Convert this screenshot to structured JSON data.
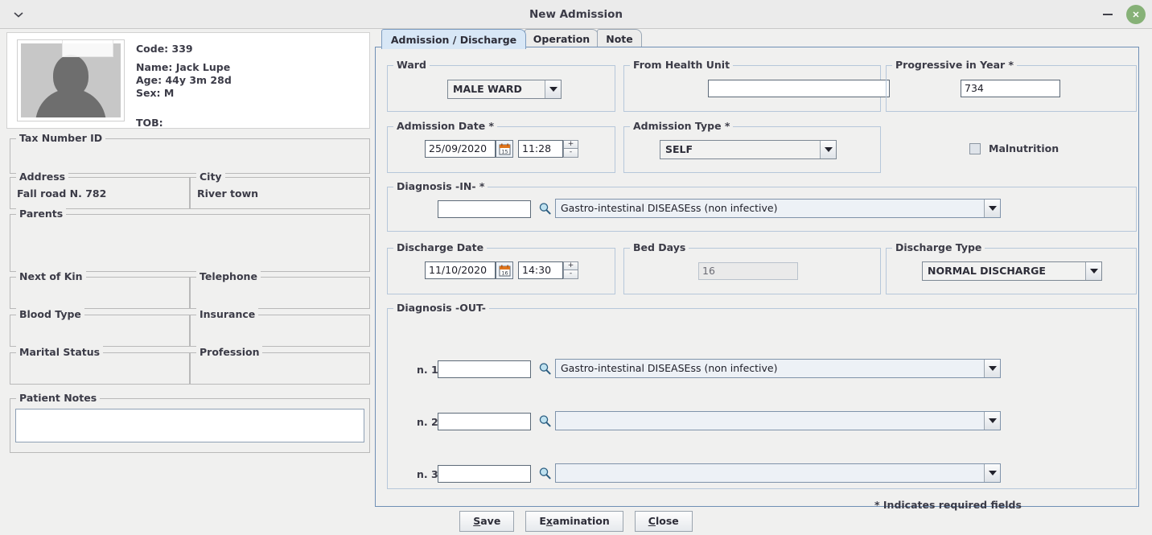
{
  "window": {
    "title": "New Admission",
    "chevron_icon": "chevron-down-icon",
    "minimize_icon": "minimize-icon",
    "close_icon": "close-icon",
    "close_color": "#86b177"
  },
  "patient": {
    "code_label": "Code: 339",
    "name_label": "Name: Jack Lupe",
    "age_label": "Age: 44y 3m 28d",
    "sex_label": "Sex: M",
    "tob_label": "TOB:",
    "avatar_icon": "avatar-placeholder-icon",
    "fields": [
      {
        "title": "Tax Number ID",
        "value": ""
      },
      {
        "title": "Address",
        "value": "Fall road N. 782"
      },
      {
        "title": "City",
        "value": "River town"
      },
      {
        "title": "Parents",
        "value": ""
      },
      {
        "title": "Next of Kin",
        "value": ""
      },
      {
        "title": "Telephone",
        "value": ""
      },
      {
        "title": "Blood Type",
        "value": ""
      },
      {
        "title": "Insurance",
        "value": ""
      },
      {
        "title": "Marital Status",
        "value": ""
      },
      {
        "title": "Profession",
        "value": ""
      },
      {
        "title": "Patient Notes",
        "value": ""
      }
    ]
  },
  "tabs": [
    {
      "label": "Admission / Discharge",
      "selected": true
    },
    {
      "label": "Operation",
      "selected": false
    },
    {
      "label": "Note",
      "selected": false
    }
  ],
  "form": {
    "ward": {
      "title": "Ward",
      "value": "MALE WARD"
    },
    "from_health_unit": {
      "title": "From Health Unit",
      "value": ""
    },
    "progressive_in_year": {
      "title": "Progressive in Year *",
      "value": "734"
    },
    "malnutrition": {
      "label": "Malnutrition",
      "checked": false
    },
    "admission_date": {
      "title": "Admission Date *",
      "date": "25/09/2020",
      "time": "11:28",
      "calendar_icon": "calendar-icon",
      "calendar_day": "15",
      "spin_up": "+",
      "spin_down": "-"
    },
    "admission_type": {
      "title": "Admission Type *",
      "value": "SELF"
    },
    "diagnosis_in": {
      "title": "Diagnosis -IN- *",
      "code": "",
      "value": "Gastro-intestinal DISEASEss (non infective)",
      "search_icon": "search-icon"
    },
    "discharge_date": {
      "title": "Discharge Date",
      "date": "11/10/2020",
      "time": "14:30",
      "calendar_icon": "calendar-icon",
      "calendar_day": "16",
      "spin_up": "+",
      "spin_down": "-"
    },
    "bed_days": {
      "title": "Bed Days",
      "value": "16"
    },
    "discharge_type": {
      "title": "Discharge Type",
      "value": "NORMAL DISCHARGE"
    },
    "diagnosis_out": {
      "title": "Diagnosis -OUT-",
      "rows": [
        {
          "label": "n. 1",
          "code": "",
          "value": "Gastro-intestinal DISEASEss (non infective)"
        },
        {
          "label": "n. 2",
          "code": "",
          "value": ""
        },
        {
          "label": "n. 3",
          "code": "",
          "value": ""
        }
      ]
    },
    "required_note": "* Indicates required fields"
  },
  "buttons": {
    "save": {
      "pre": "",
      "mn": "S",
      "post": "ave"
    },
    "examination": {
      "pre": "E",
      "mn": "x",
      "post": "amination"
    },
    "close": {
      "pre": "",
      "mn": "C",
      "post": "lose"
    }
  }
}
